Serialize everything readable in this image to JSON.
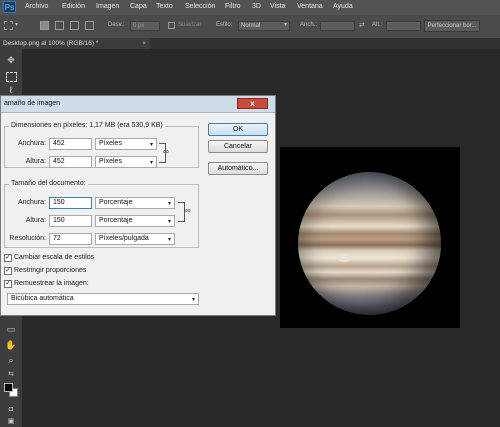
{
  "menubar": {
    "logo": "Ps",
    "items": [
      "Archivo",
      "Edición",
      "Imagen",
      "Capa",
      "Texto",
      "Selección",
      "Filtro",
      "3D",
      "Vista",
      "Ventana",
      "Ayuda"
    ]
  },
  "optbar": {
    "desv_label": "Desv.:",
    "desv_value": "0 px",
    "suavizar_label": "Suavizar",
    "estilo_label": "Estilo:",
    "estilo_value": "Normal",
    "anchura_label": "Anch.:",
    "altura_label": "Alt.:",
    "refine_button": "Perfeccionar bor..."
  },
  "document_tab": {
    "title": "Desktop.png al 100% (RGB/16) *",
    "close": "×"
  },
  "dialog": {
    "title": "amaño de imagen",
    "close": "x",
    "pixel_dims": {
      "legend": "Dimensiones en píxeles: 1,17 MB (era 530,9 KB)",
      "width_label": "Anchura:",
      "width_value": "452",
      "width_unit": "Píxeles",
      "height_label": "Altura:",
      "height_value": "452",
      "height_unit": "Píxeles"
    },
    "doc_size": {
      "legend": "Tamaño del documento:",
      "width_label": "Anchura:",
      "width_value": "150",
      "width_unit": "Porcentaje",
      "height_label": "Altura:",
      "height_value": "150",
      "height_unit": "Porcentaje",
      "res_label": "Resolución:",
      "res_value": "72",
      "res_unit": "Píxeles/pulgada"
    },
    "checkboxes": [
      {
        "label": "Cambiar escala de estilos",
        "checked": true
      },
      {
        "label": "Restringir proporciones",
        "checked": true
      },
      {
        "label": "Remuestrear la imagen:",
        "checked": true
      }
    ],
    "resample_method": "Bicúbica automática",
    "buttons": {
      "ok": "OK",
      "cancel": "Cancelar",
      "auto": "Automático..."
    }
  }
}
